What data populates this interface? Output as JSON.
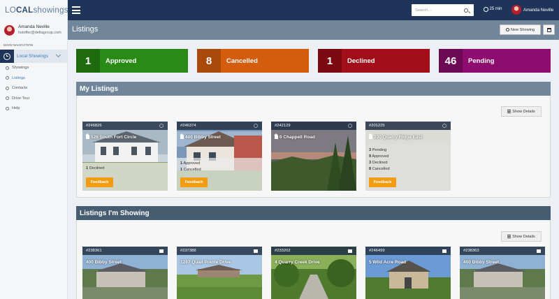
{
  "app": {
    "logo": {
      "part_a": "L",
      "part_o": "O",
      "part_b": "CAL",
      "part_c": "showings"
    }
  },
  "sidebar": {
    "user_name": "Amanda Neville",
    "user_email": "hstoffer@deltagroup.com",
    "nav_header": "MAIN NAVIGATION",
    "main_item": "Local Showings",
    "items": [
      {
        "label": "Showings",
        "active": false
      },
      {
        "label": "Listings",
        "active": true
      },
      {
        "label": "Contacts",
        "active": false
      },
      {
        "label": "Drive Tour",
        "active": false
      },
      {
        "label": "Help",
        "active": false
      }
    ]
  },
  "topbar": {
    "search_placeholder": "Search...",
    "timer": "25 min",
    "user_name": "Amanda Neville"
  },
  "page": {
    "title": "Listings",
    "new_showing_label": "New Showing"
  },
  "stats": [
    {
      "count": "1",
      "label": "Approved",
      "color": "#2a8a16",
      "dark": "#1f6a0f"
    },
    {
      "count": "8",
      "label": "Cancelled",
      "color": "#d35d0d",
      "dark": "#a8480a"
    },
    {
      "count": "1",
      "label": "Declined",
      "color": "#a10d18",
      "dark": "#7c0912"
    },
    {
      "count": "46",
      "label": "Pending",
      "color": "#8e0b6f",
      "dark": "#6c0854"
    }
  ],
  "my_listings": {
    "title": "My Listings",
    "show_details_label": "Show Details",
    "feedback_label": "Feedback",
    "cards": [
      {
        "id": "#246826",
        "address": "526 South Fort Circle",
        "stats": [
          {
            "n": "1",
            "label": "Declined"
          }
        ],
        "has_feedback": true
      },
      {
        "id": "#246374",
        "address": "400 Bibby Street",
        "stats": [
          {
            "n": "1",
            "label": "Approved"
          },
          {
            "n": "1",
            "label": "Cancelled"
          }
        ],
        "has_feedback": true
      },
      {
        "id": "#242129",
        "address": "0 Chappell Road",
        "stats": [],
        "has_feedback": false
      },
      {
        "id": "#201225",
        "address": "230 Quarry Ridge East",
        "stats": [
          {
            "n": "3",
            "label": "Pending"
          },
          {
            "n": "9",
            "label": "Approved"
          },
          {
            "n": "3",
            "label": "Declined"
          },
          {
            "n": "8",
            "label": "Cancelled"
          }
        ],
        "has_feedback": true
      }
    ]
  },
  "showing": {
    "title": "Listings I'm Showing",
    "show_details_label": "Show Details",
    "cards": [
      {
        "id": "#238361",
        "address": "400 Bibby Street"
      },
      {
        "id": "#237388",
        "address": "1287 Quail Pointe Drive"
      },
      {
        "id": "#233202",
        "address": "4 Quarry Creek Drive"
      },
      {
        "id": "#246499",
        "address": "5 Wild Acre Road"
      },
      {
        "id": "#238363",
        "address": "400 Bibby Street"
      }
    ]
  }
}
